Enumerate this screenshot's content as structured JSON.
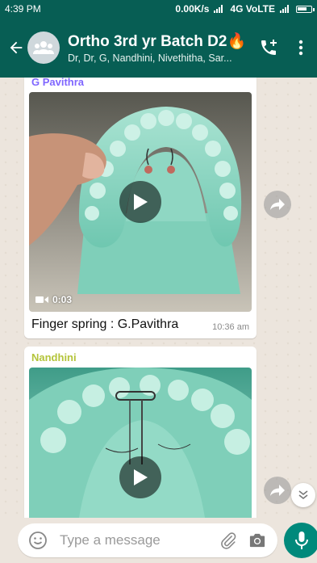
{
  "status_bar": {
    "time": "4:39 PM",
    "network": "0.00K/s",
    "carrier": "4G VoLTE"
  },
  "header": {
    "title": "Ortho 3rd yr Batch D2",
    "title_emoji": "🔥",
    "subtitle": "Dr, Dr, G, Nandhini, Nivethitha, Sar...",
    "background": "#075e54"
  },
  "messages": [
    {
      "sender": "G Pavithra",
      "sender_color": "#7f66ff",
      "type": "video",
      "duration": "0:03",
      "caption": "Finger spring : G.Pavithra",
      "time": "10:36 am"
    },
    {
      "sender": "Nandhini",
      "sender_color": "#b4c43a",
      "type": "video"
    }
  ],
  "input": {
    "placeholder": "Type a message",
    "value": ""
  },
  "colors": {
    "accent": "#00897b",
    "chat_bg": "#ece5dd"
  }
}
